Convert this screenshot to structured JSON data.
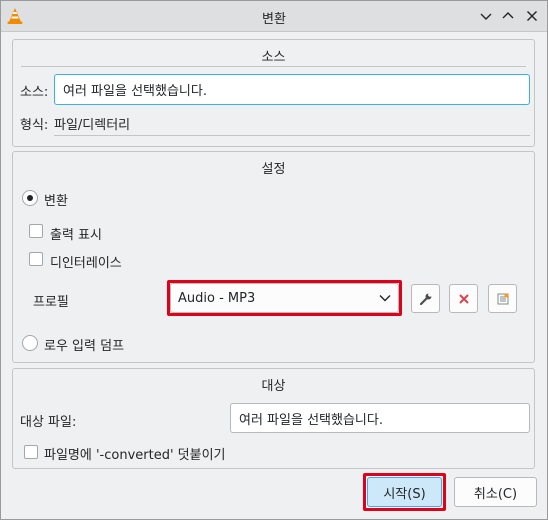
{
  "window": {
    "title": "변환"
  },
  "source_group": {
    "title": "소스",
    "source_label": "소스:",
    "source_value": "여러 파일을 선택했습니다.",
    "format_label": "형식:",
    "format_value": "파일/디렉터리"
  },
  "settings_group": {
    "title": "설정",
    "convert_label": "변환",
    "show_output_label": "출력 표시",
    "deinterlace_label": "디인터레이스",
    "profile_label": "프로필",
    "profile_selected": "Audio - MP3",
    "dump_raw_label": "로우 입력 덤프"
  },
  "destination_group": {
    "title": "대상",
    "dest_file_label": "대상 파일:",
    "dest_file_value": "여러 파일을 선택했습니다.",
    "append_label": "파일명에 '-converted' 덧붙이기"
  },
  "buttons": {
    "start": "시작(S)",
    "cancel": "취소(C)"
  },
  "colors": {
    "accent": "#3daee9",
    "highlight": "#e0001a",
    "delete": "#da4453"
  }
}
